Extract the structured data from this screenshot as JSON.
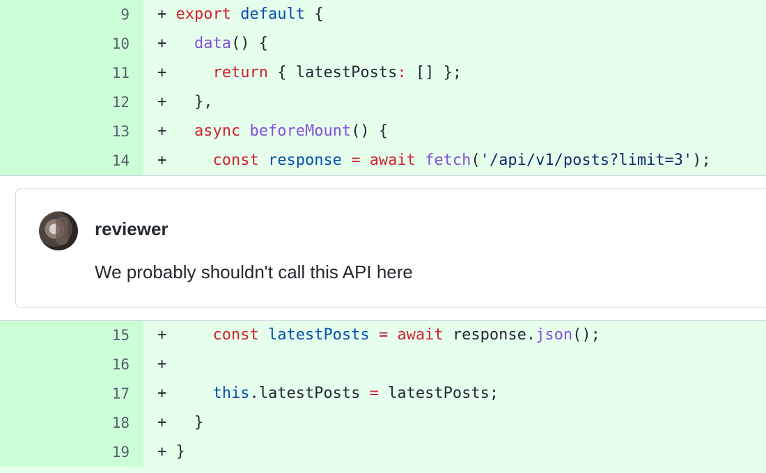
{
  "diff_top": [
    {
      "line": "9",
      "marker": "+",
      "tokens": [
        {
          "t": " ",
          "cls": "p"
        },
        {
          "t": "export",
          "cls": "k"
        },
        {
          "t": " ",
          "cls": "p"
        },
        {
          "t": "default",
          "cls": "c"
        },
        {
          "t": " {",
          "cls": "p"
        }
      ]
    },
    {
      "line": "10",
      "marker": "+",
      "tokens": [
        {
          "t": "   ",
          "cls": "p"
        },
        {
          "t": "data",
          "cls": "f"
        },
        {
          "t": "() {",
          "cls": "p"
        }
      ]
    },
    {
      "line": "11",
      "marker": "+",
      "tokens": [
        {
          "t": "     ",
          "cls": "p"
        },
        {
          "t": "return",
          "cls": "k"
        },
        {
          "t": " { latestPosts",
          "cls": "p"
        },
        {
          "t": ":",
          "cls": "k"
        },
        {
          "t": " [] };",
          "cls": "p"
        }
      ]
    },
    {
      "line": "12",
      "marker": "+",
      "tokens": [
        {
          "t": "   },",
          "cls": "p"
        }
      ]
    },
    {
      "line": "13",
      "marker": "+",
      "tokens": [
        {
          "t": "   ",
          "cls": "p"
        },
        {
          "t": "async",
          "cls": "k"
        },
        {
          "t": " ",
          "cls": "p"
        },
        {
          "t": "beforeMount",
          "cls": "f"
        },
        {
          "t": "() {",
          "cls": "p"
        }
      ]
    },
    {
      "line": "14",
      "marker": "+",
      "tokens": [
        {
          "t": "     ",
          "cls": "p"
        },
        {
          "t": "const",
          "cls": "k"
        },
        {
          "t": " ",
          "cls": "p"
        },
        {
          "t": "response",
          "cls": "c"
        },
        {
          "t": " ",
          "cls": "p"
        },
        {
          "t": "=",
          "cls": "k"
        },
        {
          "t": " ",
          "cls": "p"
        },
        {
          "t": "await",
          "cls": "k"
        },
        {
          "t": " ",
          "cls": "p"
        },
        {
          "t": "fetch",
          "cls": "f"
        },
        {
          "t": "(",
          "cls": "p"
        },
        {
          "t": "'/api/v1/posts?limit=3'",
          "cls": "s"
        },
        {
          "t": ");",
          "cls": "p"
        }
      ]
    }
  ],
  "comment": {
    "author": "reviewer",
    "body": "We probably shouldn't call this API here",
    "avatar_icon": "user-avatar-icon"
  },
  "diff_bottom": [
    {
      "line": "15",
      "marker": "+",
      "tokens": [
        {
          "t": "     ",
          "cls": "p"
        },
        {
          "t": "const",
          "cls": "k"
        },
        {
          "t": " ",
          "cls": "p"
        },
        {
          "t": "latestPosts",
          "cls": "c"
        },
        {
          "t": " ",
          "cls": "p"
        },
        {
          "t": "=",
          "cls": "k"
        },
        {
          "t": " ",
          "cls": "p"
        },
        {
          "t": "await",
          "cls": "k"
        },
        {
          "t": " response.",
          "cls": "p"
        },
        {
          "t": "json",
          "cls": "f"
        },
        {
          "t": "();",
          "cls": "p"
        }
      ]
    },
    {
      "line": "16",
      "marker": "+",
      "tokens": []
    },
    {
      "line": "17",
      "marker": "+",
      "tokens": [
        {
          "t": "     ",
          "cls": "p"
        },
        {
          "t": "this",
          "cls": "c"
        },
        {
          "t": ".latestPosts ",
          "cls": "p"
        },
        {
          "t": "=",
          "cls": "k"
        },
        {
          "t": " latestPosts;",
          "cls": "p"
        }
      ]
    },
    {
      "line": "18",
      "marker": "+",
      "tokens": [
        {
          "t": "   }",
          "cls": "p"
        }
      ]
    },
    {
      "line": "19",
      "marker": "+",
      "tokens": [
        {
          "t": " }",
          "cls": "p"
        }
      ]
    }
  ],
  "colors": {
    "added_bg": "#e6ffec",
    "added_gutter": "#ccffd8",
    "keyword": "#cf222e",
    "function": "#8250df",
    "constant": "#0550ae",
    "string": "#0a3069"
  }
}
